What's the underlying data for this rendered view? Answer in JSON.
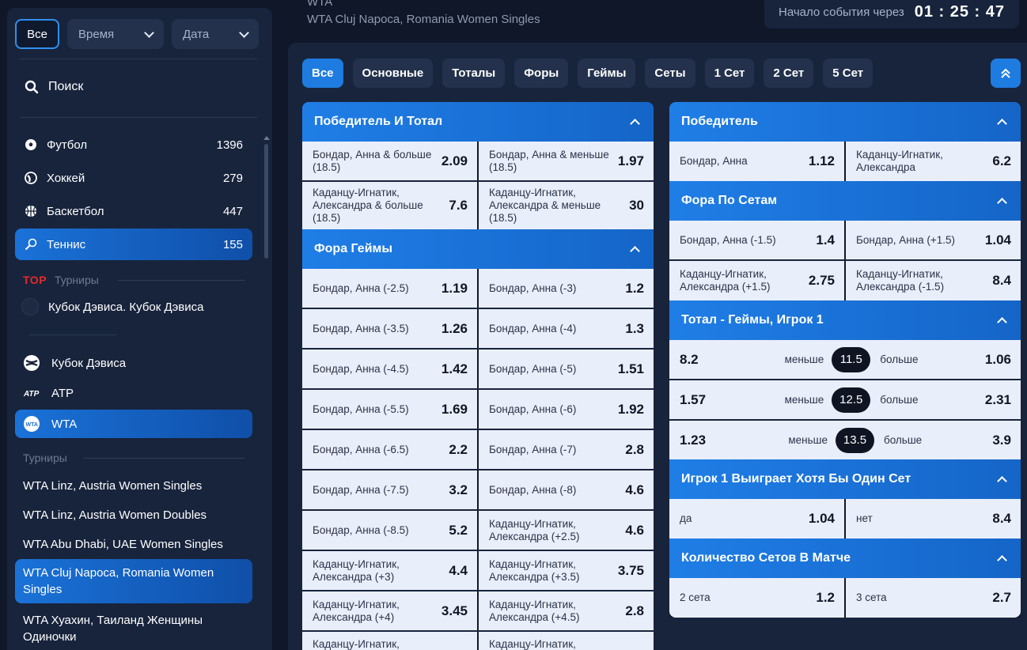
{
  "sidebar": {
    "filters": {
      "all": "Все",
      "time": "Время",
      "date": "Дата"
    },
    "search": "Поиск",
    "sports": [
      {
        "name": "Футбол",
        "count": "1396",
        "icon": "football-icon"
      },
      {
        "name": "Хоккей",
        "count": "279",
        "icon": "hockey-icon"
      },
      {
        "name": "Баскетбол",
        "count": "447",
        "icon": "basketball-icon"
      },
      {
        "name": "Теннис",
        "count": "155",
        "icon": "tennis-icon"
      }
    ],
    "top_badge": "TOP",
    "top_label": "Турниры",
    "top_cup": "Кубок Дэвиса. Кубок Дэвиса",
    "tours": [
      {
        "name": "Кубок Дэвиса",
        "icon": "davis-cup-icon"
      },
      {
        "name": "ATP",
        "icon": "atp-icon"
      },
      {
        "name": "WTA",
        "icon": "wta-icon"
      }
    ],
    "tournaments_label": "Турниры",
    "leagues": [
      "WTA Linz, Austria Women Singles",
      "WTA Linz, Austria Women Doubles",
      "WTA Abu Dhabi, UAE Women Singles",
      "WTA Cluj Napoca, Romania Women Singles",
      "WTA Хуахин, Таиланд Женщины Одиночки"
    ]
  },
  "header": {
    "sport": "WTA",
    "event": "WTA Cluj Napoca, Romania Women Singles",
    "countdown_label": "Начало события через",
    "countdown_time": "01 : 25 : 47"
  },
  "tabs": [
    "Все",
    "Основные",
    "Тоталы",
    "Форы",
    "Геймы",
    "Сеты",
    "1 Сет",
    "2 Сет",
    "5 Сет"
  ],
  "left": {
    "winner_total": {
      "title": "Победитель И Тотал",
      "rows": [
        [
          {
            "name": "Бондар, Анна & больше (18.5)",
            "odd": "2.09"
          },
          {
            "name": "Бондар, Анна & меньше (18.5)",
            "odd": "1.97"
          }
        ],
        [
          {
            "name": "Каданцу-Игнатик, Александра & больше (18.5)",
            "odd": "7.6"
          },
          {
            "name": "Каданцу-Игнатик, Александра & меньше (18.5)",
            "odd": "30"
          }
        ]
      ]
    },
    "fora_games": {
      "title": "Фора Геймы",
      "rows": [
        [
          {
            "name": "Бондар, Анна (-2.5)",
            "odd": "1.19"
          },
          {
            "name": "Бондар, Анна (-3)",
            "odd": "1.2"
          }
        ],
        [
          {
            "name": "Бондар, Анна (-3.5)",
            "odd": "1.26"
          },
          {
            "name": "Бондар, Анна (-4)",
            "odd": "1.3"
          }
        ],
        [
          {
            "name": "Бондар, Анна (-4.5)",
            "odd": "1.42"
          },
          {
            "name": "Бондар, Анна (-5)",
            "odd": "1.51"
          }
        ],
        [
          {
            "name": "Бондар, Анна (-5.5)",
            "odd": "1.69"
          },
          {
            "name": "Бондар, Анна (-6)",
            "odd": "1.92"
          }
        ],
        [
          {
            "name": "Бондар, Анна (-6.5)",
            "odd": "2.2"
          },
          {
            "name": "Бондар, Анна (-7)",
            "odd": "2.8"
          }
        ],
        [
          {
            "name": "Бондар, Анна (-7.5)",
            "odd": "3.2"
          },
          {
            "name": "Бондар, Анна (-8)",
            "odd": "4.6"
          }
        ],
        [
          {
            "name": "Бондар, Анна (-8.5)",
            "odd": "5.2"
          },
          {
            "name": "Каданцу-Игнатик, Александра (+2.5)",
            "odd": "4.6"
          }
        ],
        [
          {
            "name": "Каданцу-Игнатик, Александра (+3)",
            "odd": "4.4"
          },
          {
            "name": "Каданцу-Игнатик, Александра (+3.5)",
            "odd": "3.75"
          }
        ],
        [
          {
            "name": "Каданцу-Игнатик, Александра (+4)",
            "odd": "3.45"
          },
          {
            "name": "Каданцу-Игнатик, Александра (+4.5)",
            "odd": "2.8"
          }
        ],
        [
          {
            "name": "Каданцу-Игнатик, Александра",
            "odd": ""
          },
          {
            "name": "Каданцу-Игнатик, Александра",
            "odd": ""
          }
        ]
      ]
    }
  },
  "right": {
    "winner": {
      "title": "Победитель",
      "rows": [
        [
          {
            "name": "Бондар, Анна",
            "odd": "1.12"
          },
          {
            "name": "Каданцу-Игнатик, Александра",
            "odd": "6.2"
          }
        ]
      ]
    },
    "fora_sets": {
      "title": "Фора По Сетам",
      "rows": [
        [
          {
            "name": "Бондар, Анна (-1.5)",
            "odd": "1.4"
          },
          {
            "name": "Бондар, Анна (+1.5)",
            "odd": "1.04"
          }
        ],
        [
          {
            "name": "Каданцу-Игнатик, Александра (+1.5)",
            "odd": "2.75"
          },
          {
            "name": "Каданцу-Игнатик, Александра (-1.5)",
            "odd": "8.4"
          }
        ]
      ]
    },
    "total_games": {
      "title": "Тотал - Геймы, Игрок 1",
      "under_label": "меньше",
      "over_label": "больше",
      "rows": [
        {
          "under": "8.2",
          "line": "11.5",
          "over": "1.06"
        },
        {
          "under": "1.57",
          "line": "12.5",
          "over": "2.31"
        },
        {
          "under": "1.23",
          "line": "13.5",
          "over": "3.9"
        }
      ]
    },
    "win_set": {
      "title": "Игрок 1 Выиграет Хотя Бы Один Сет",
      "rows": [
        [
          {
            "name": "да",
            "odd": "1.04"
          },
          {
            "name": "нет",
            "odd": "8.4"
          }
        ]
      ]
    },
    "sets_count": {
      "title": "Количество Сетов В Матче",
      "rows": [
        [
          {
            "name": "2 сета",
            "odd": "1.2"
          },
          {
            "name": "3 сета",
            "odd": "2.7"
          }
        ]
      ]
    }
  },
  "colors": {
    "accent": "#1e7ce0",
    "panel": "#18243c",
    "background": "#0f1729",
    "cell": "#e9eefb",
    "top_badge": "#e42a2a"
  }
}
